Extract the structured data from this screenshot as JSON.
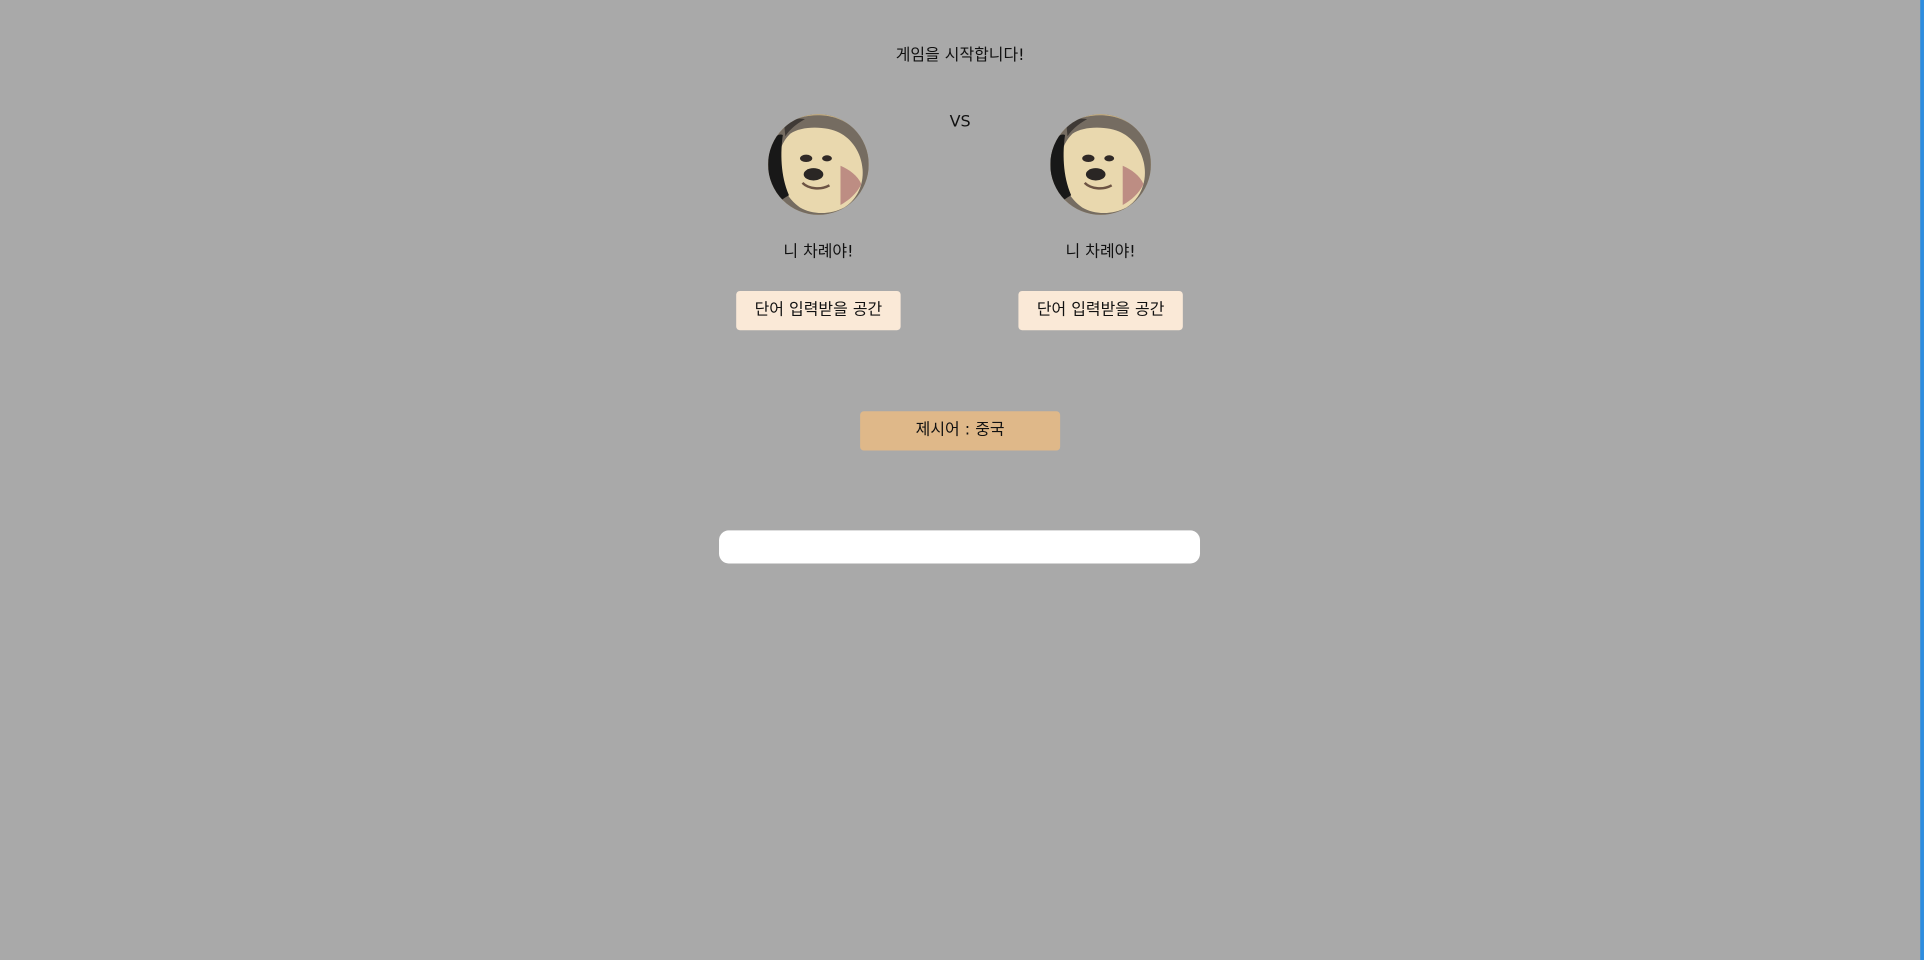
{
  "game": {
    "title": "게임을 시작합니다!",
    "vs": "VS",
    "prompt": "제시어 : 중국",
    "answer_input_value": "",
    "players": [
      {
        "turn_text": "니 차례야!",
        "word_box_label": "단어 입력받을 공간"
      },
      {
        "turn_text": "니 차례야!",
        "word_box_label": "단어 입력받을 공간"
      }
    ]
  },
  "colors": {
    "background": "#a9a9a9",
    "word_box": "#fae9d7",
    "prompt_box": "#dfb889",
    "input": "#ffffff",
    "edge_accent": "#2d8de0"
  },
  "icons": {
    "avatar": "dog-avatar"
  }
}
